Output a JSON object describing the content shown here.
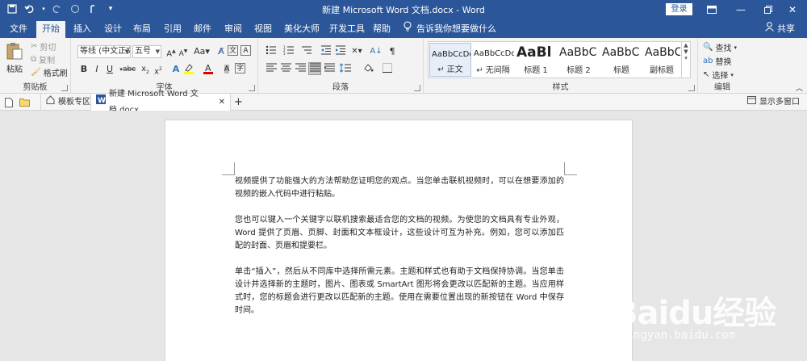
{
  "title_bar": {
    "title": "新建 Microsoft Word 文档.docx  -  Word",
    "login_label": "登录",
    "accent_color": "#2b579a"
  },
  "quick_access": [
    "save-icon",
    "undo-icon",
    "redo-icon",
    "circle-icon",
    "touch-mode-icon",
    "customize-icon"
  ],
  "tabs": [
    {
      "label": "文件"
    },
    {
      "label": "开始"
    },
    {
      "label": "插入"
    },
    {
      "label": "设计"
    },
    {
      "label": "布局"
    },
    {
      "label": "引用"
    },
    {
      "label": "邮件"
    },
    {
      "label": "审阅"
    },
    {
      "label": "视图"
    },
    {
      "label": "美化大师"
    },
    {
      "label": "开发工具"
    },
    {
      "label": "帮助"
    }
  ],
  "active_tab": "开始",
  "tell_me": "告诉我你想要做什么",
  "share_label": "共享",
  "ribbon": {
    "clipboard": {
      "paste": "粘贴",
      "cut": "剪切",
      "copy": "复制",
      "format_painter": "格式刷",
      "label": "剪贴板"
    },
    "font": {
      "font_name": "等线 (中文正文)",
      "font_size": "五号",
      "label": "字体"
    },
    "paragraph": {
      "label": "段落"
    },
    "styles": {
      "label": "样式",
      "items": [
        {
          "preview": "AaBbCcDd",
          "name": "↵ 正文"
        },
        {
          "preview": "AaBbCcDd",
          "name": "↵ 无间隔"
        },
        {
          "preview": "AaBl",
          "name": "标题 1"
        },
        {
          "preview": "AaBbC",
          "name": "标题 2"
        },
        {
          "preview": "AaBbC",
          "name": "标题"
        },
        {
          "preview": "AaBbC",
          "name": "副标题"
        }
      ]
    },
    "editing": {
      "find": "查找",
      "replace": "替换",
      "select": "选择",
      "label": "编辑"
    }
  },
  "doc_tabs": {
    "templates": "模板专区",
    "current_doc": "新建 Microsoft Word 文档.docx",
    "multi_window": "显示多窗口"
  },
  "document": {
    "paragraphs": [
      "视频提供了功能强大的方法帮助您证明您的观点。当您单击联机视频时，可以在想要添加的视频的嵌入代码中进行粘贴。",
      "您也可以键入一个关键字以联机搜索最适合您的文档的视频。为使您的文档具有专业外观，Word 提供了页眉、页脚、封面和文本框设计，这些设计可互为补充。例如，您可以添加匹配的封面、页眉和提要栏。",
      "单击“插入”，然后从不同库中选择所需元素。主题和样式也有助于文档保持协调。当您单击设计并选择新的主题时，图片、图表或 SmartArt 图形将会更改以匹配新的主题。当应用样式时，您的标题会进行更改以匹配新的主题。使用在需要位置出现的新按钮在 Word 中保存时间。"
    ]
  },
  "watermark": {
    "brand": "Baidu经验",
    "url": "jingyan.baidu.com"
  }
}
